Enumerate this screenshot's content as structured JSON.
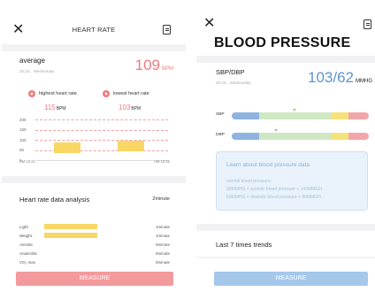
{
  "heart_rate": {
    "title": "HEART RATE",
    "average_label": "average",
    "average_date": "20:24、Wednesday",
    "average_value": "109",
    "average_unit": "BPM",
    "highest_label": "highest heart rate",
    "highest_value": "115",
    "highest_unit": "BPM",
    "lowest_label": "lowest heart rate",
    "lowest_value": "103",
    "lowest_unit": "BPM",
    "chart": {
      "y_ticks": [
        "200",
        "150",
        "100",
        "50",
        "0"
      ],
      "x_start": "AM 10:21",
      "x_end": "AM 10:25",
      "bars": [
        {
          "min": 35,
          "max": 85
        },
        {
          "min": 45,
          "max": 95
        }
      ],
      "ylim": [
        0,
        200
      ]
    },
    "analysis_title": "Heart rate data analysis",
    "analysis_duration": "2minute",
    "zones": [
      {
        "name": "Light",
        "duration": "1minute",
        "fraction": 1.0
      },
      {
        "name": "Weight",
        "duration": "1minute",
        "fraction": 1.0
      },
      {
        "name": "Aerobic",
        "duration": "0minute",
        "fraction": 0
      },
      {
        "name": "Anaerobic",
        "duration": "0minute",
        "fraction": 0
      },
      {
        "name": "VO₂ max",
        "duration": "0minute",
        "fraction": 0
      }
    ],
    "measure_label": "MEASURE",
    "colors": {
      "accent": "#f07a7e",
      "bar": "#f8d764",
      "button": "#f39a9c"
    }
  },
  "blood_pressure": {
    "title": "BLOOD PRESSURE",
    "sbp_dbp_label": "SBP/DBP",
    "date": "20:24、Wednesday",
    "value": "103/62",
    "unit": "MMHG",
    "sbp_label": "SBP",
    "dbp_label": "DBP",
    "sbp_marker_fraction": 0.46,
    "dbp_marker_fraction": 0.32,
    "info_title": "Learn about blood pressure data",
    "info_heading": "normal blood pressure:",
    "info_line1": "90MMHG < systolic blood pressure < 140MMGH",
    "info_line2": "60MMHG < diastolic blood pressure < 90MMGH",
    "trends_label": "Last 7 times trends",
    "measure_label": "MEASURE",
    "colors": {
      "value": "#5d95cf",
      "button": "#a5c8ea",
      "scale_blue": "#8fb4e0",
      "scale_green": "#cfe8c4",
      "scale_yellow": "#f6e27a",
      "scale_red": "#f3a6a8"
    }
  }
}
